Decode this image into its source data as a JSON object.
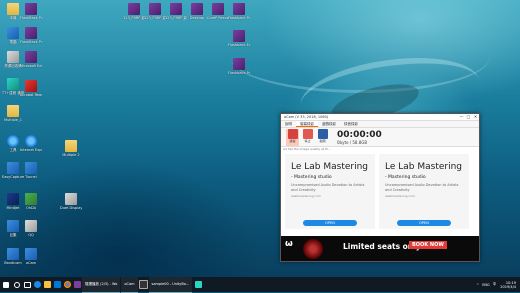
{
  "desktop": {
    "icons": [
      {
        "label": "本機",
        "color": "gray"
      },
      {
        "label": "FlashBack Pro 5 Player",
        "color": "purple"
      },
      {
        "label": "電腦",
        "color": "blue"
      },
      {
        "label": "FlashBack Pro 5 Re...",
        "color": "purple"
      },
      {
        "label": "資源回收筒",
        "color": "gray"
      },
      {
        "label": "Microsoft Edge",
        "color": "purple"
      },
      {
        "label": "TT+遠程 通用版",
        "color": "teal"
      },
      {
        "label": "Acrobat Reader",
        "color": "red"
      },
      {
        "label": "Multiple_1",
        "color": "folder"
      },
      {
        "label": "工具",
        "color": "ie"
      },
      {
        "label": "Internet Explorer",
        "color": "ie"
      },
      {
        "label": "Multiple 2",
        "color": "folder"
      },
      {
        "label": "EasyCapture",
        "color": "blue"
      },
      {
        "label": "Tunnel",
        "color": "blue"
      },
      {
        "label": "Mindjet",
        "color": "darkblue"
      },
      {
        "label": "OhDA",
        "color": "green"
      },
      {
        "label": "Duet Display",
        "color": "gray"
      },
      {
        "label": "巨集",
        "color": "blue"
      },
      {
        "label": "QQ",
        "color": "gray"
      },
      {
        "label": "Bandicam",
        "color": "blue"
      },
      {
        "label": "oCam",
        "color": "blue"
      },
      {
        "label": "123_FBRP 影音教學1",
        "color": "purple"
      },
      {
        "label": "123_FBRP 影音教學2",
        "color": "purple"
      },
      {
        "label": "123_FBRP 影音教學3",
        "color": "purple"
      },
      {
        "label": "Desktop",
        "color": "purple"
      },
      {
        "label": "CoreP Recorder",
        "color": "purple"
      },
      {
        "label": "Flashback Pro 5 Recorder",
        "color": "purple"
      },
      {
        "label": "Flashback Express 5",
        "color": "purple"
      },
      {
        "label": "Flashback Pro 5 說明",
        "color": "purple"
      }
    ]
  },
  "window": {
    "title": "oCam (V 33, 2018, 1080)",
    "controls": {
      "min": "—",
      "max": "□",
      "close": "✕"
    },
    "menu": [
      "說明",
      "螢幕錄影",
      "遊戲錄影",
      "錄音錄影"
    ],
    "tools": [
      {
        "label": "錄製",
        "kind": "rec"
      },
      {
        "label": "停止",
        "kind": "pause"
      },
      {
        "label": "截圖",
        "kind": "stop"
      }
    ],
    "timer": "00:00:00",
    "size": "0byte / 58.8GB",
    "ad_note": "Ad Set the image quality at th...",
    "ads": [
      {
        "heading": "Le Lab Mastering",
        "sub": "- Mastering studio",
        "desc": "Uncompromised Audio Devotion to Artists and Creativity",
        "url": "lelabmastering.com",
        "button": "OPEN"
      },
      {
        "heading": "Le Lab Mastering",
        "sub": "- Mastering studio",
        "desc": "Uncompromised Audio Devotion to Artists and Creativity",
        "url": "lelabmastering.com",
        "button": "OPEN"
      }
    ],
    "banner": {
      "logo": "ω",
      "text": "Limited seats only!",
      "cta": "BOOK NOW"
    }
  },
  "taskbar": {
    "running": [
      "隨選播放 (2/3) - Wo",
      "oCam",
      "sample00 - UnityBo..."
    ],
    "tray": [
      "^",
      "ENG",
      "中"
    ],
    "time": "10:19",
    "date": "2019/4/4"
  }
}
